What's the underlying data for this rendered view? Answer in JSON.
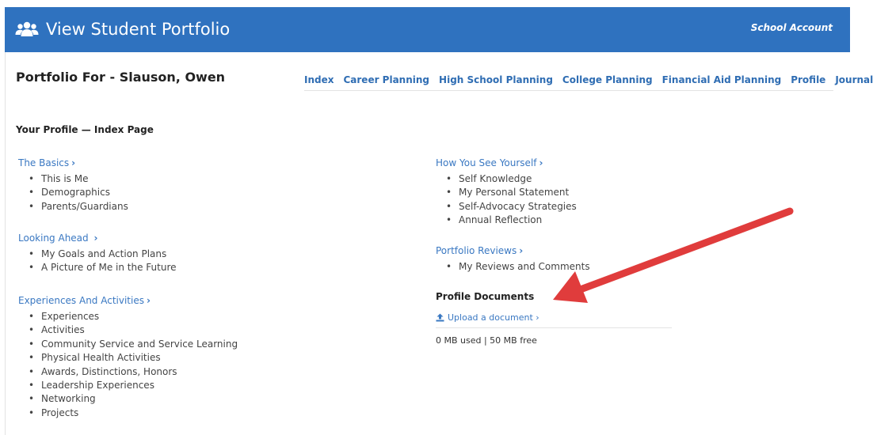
{
  "header": {
    "title": "View Student Portfolio",
    "account": "School Account",
    "icon": "people-icon"
  },
  "portfolio_title": "Portfolio For - Slauson, Owen",
  "nav": [
    {
      "label": "Index"
    },
    {
      "label": "Career Planning"
    },
    {
      "label": "High School Planning"
    },
    {
      "label": "College Planning"
    },
    {
      "label": "Financial Aid Planning"
    },
    {
      "label": "Profile"
    },
    {
      "label": "Journal"
    }
  ],
  "page_heading": "Your Profile — Index Page",
  "sections": {
    "basics": {
      "title": "The Basics",
      "items": [
        "This is Me",
        "Demographics",
        "Parents/Guardians"
      ]
    },
    "looking_ahead": {
      "title": "Looking Ahead",
      "items": [
        "My Goals and Action Plans",
        "A Picture of Me in the Future"
      ]
    },
    "experiences": {
      "title": "Experiences And Activities",
      "items": [
        "Experiences",
        "Activities",
        "Community Service and Service Learning",
        "Physical Health Activities",
        "Awards, Distinctions, Honors",
        "Leadership Experiences",
        "Networking",
        "Projects"
      ]
    },
    "how_you_see": {
      "title": "How You See Yourself",
      "items": [
        "Self Knowledge",
        "My Personal Statement",
        "Self-Advocacy Strategies",
        "Annual Reflection"
      ]
    },
    "reviews": {
      "title": "Portfolio Reviews",
      "items": [
        "My Reviews and Comments"
      ]
    }
  },
  "documents": {
    "title": "Profile Documents",
    "upload_label": "Upload a document ›",
    "usage": "0 MB used | 50 MB free"
  },
  "colors": {
    "header_bg": "#2f72bf",
    "link": "#3a78c2",
    "annotation_arrow": "#e03c3c"
  }
}
